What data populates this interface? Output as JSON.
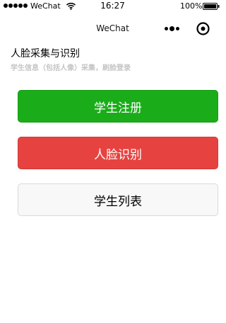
{
  "status_bar": {
    "carrier": "WeChat",
    "time": "16:27",
    "battery": "100%",
    "icons": [
      "signal-icon",
      "wifi-icon",
      "battery-icon"
    ]
  },
  "nav_bar": {
    "title": "WeChat",
    "icons": [
      "more-icon",
      "close-icon"
    ]
  },
  "header": {
    "title": "人脸采集与识别",
    "subtitle": "学生信息（包括人像）采集，刷脸登录"
  },
  "buttons": {
    "register": "学生注册",
    "recognize": "人脸识别",
    "list": "学生列表"
  },
  "colors": {
    "primary": "#1aad19",
    "warn": "#e64340",
    "default": "#f8f8f8",
    "subtitle": "#c4c4c4"
  }
}
